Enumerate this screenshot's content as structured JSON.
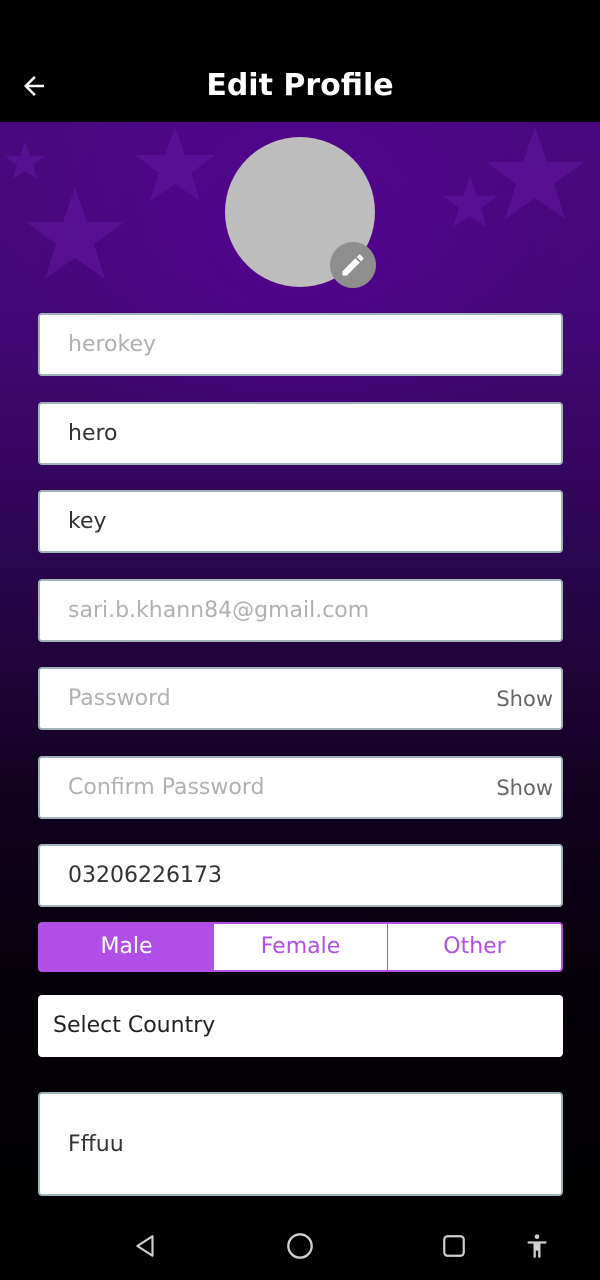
{
  "header": {
    "title": "Edit Profile",
    "back_icon": "arrow-left-icon"
  },
  "avatar": {
    "edit_icon": "pencil-icon"
  },
  "form": {
    "username": {
      "value": "",
      "placeholder": "herokey"
    },
    "first_name": {
      "value": "hero"
    },
    "last_name": {
      "value": "key"
    },
    "email": {
      "value": "sari.b.khann84@gmail.com"
    },
    "password": {
      "placeholder": "Password",
      "show_label": "Show"
    },
    "confirm_password": {
      "placeholder": "Confirm Password",
      "show_label": "Show"
    },
    "phone": {
      "value": "03206226173"
    },
    "gender": {
      "options": [
        "Male",
        "Female",
        "Other"
      ],
      "selected": "Male"
    },
    "country": {
      "label": "Select Country"
    },
    "bio": {
      "value": "Fffuu"
    }
  },
  "colors": {
    "accent": "#b14ee6",
    "background_top": "#4a0880",
    "background_bottom": "#000000"
  },
  "nav": {
    "back_icon": "triangle-back-icon",
    "home_icon": "circle-home-icon",
    "recents_icon": "square-recents-icon",
    "accessibility_icon": "accessibility-icon"
  }
}
